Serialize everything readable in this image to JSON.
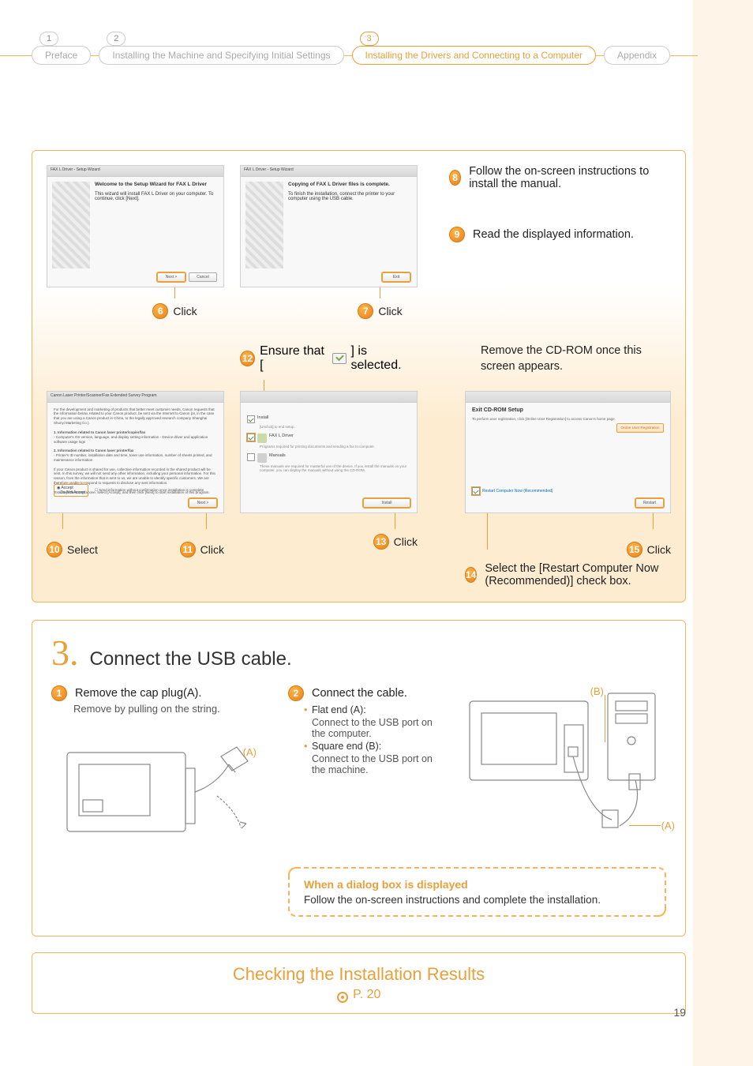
{
  "breadcrumb": {
    "items": [
      {
        "num": "1",
        "label": "Preface",
        "active": false
      },
      {
        "num": "2",
        "label": "Installing the Machine and Specifying Initial Settings",
        "active": false
      },
      {
        "num": "3",
        "label": "Installing the Drivers and Connecting to a Computer",
        "active": true
      },
      {
        "num": "",
        "label": "Appendix",
        "active": false
      }
    ]
  },
  "wizard1": {
    "titlebar": "FAX L Driver - Setup Wizard",
    "heading": "Welcome to the Setup Wizard for FAX L Driver",
    "body": "This wizard will install FAX L Driver on your computer. To continue, click [Next].",
    "buttons": {
      "next": "Next >",
      "cancel": "Cancel"
    }
  },
  "wizard2": {
    "titlebar": "FAX L Driver - Setup Wizard",
    "heading": "Copying of FAX L Driver files is complete.",
    "body": "To finish the installation, connect the printer to your computer using the USB cable.",
    "buttons": {
      "exit": "Exit"
    }
  },
  "steps": {
    "s6": "Click",
    "s7": "Click",
    "s8": "Follow the on-screen instructions to install the manual.",
    "s9": "Read the displayed information.",
    "s10": "Select",
    "s11": "Click",
    "s12_pre": "Ensure that [",
    "s12_post": "] is selected.",
    "s13": "Click",
    "s14": "Select the [Restart Computer Now (Recommended)] check box.",
    "s15": "Click",
    "remove_cd": "Remove the CD-ROM once this screen appears."
  },
  "license_shot": {
    "titlebar": "Canon Laser Printer/Scanner/Fax Extended Survey Program",
    "line1": "For the development and marketing of products that better meet customer needs, Canon requests that the information below, related to your Canon product, be sent via the Internet to Canon (or, in the case that you are using a Canon product in China, to the legally approved research company Shanghai Shunyi Marketing Co.).",
    "block1_title": "1. Information related to Canon laser printer/copier/fax",
    "block1_body": "- Computer's OS version, language, and display setting information\n- Device driver and application software usage logs",
    "block2_title": "2. Information related to Canon laser printer/fax",
    "block2_body": "- Printer's ID number, installation date and time, toner use information, number of sheets printed, and maintenance information",
    "block3": "If your Canon product is shared for use, collective information recorded in the shared product will be sent. In this survey, we will not send any other information, including your personal information. For this reason, from the information that is sent to us, we are unable to identify specific customers. We are therefore unable to respond to requests to disclose any sent information.",
    "footer": "To accept the terms above, select [Accept], and then click [Next] to start installation of this program.",
    "radio_accept": "Accept",
    "radio_decline": "Do Not Accept",
    "chk_label": "Send information without confirmation once installation is complete",
    "next": "Next >"
  },
  "select_shot": {
    "item1": "Install",
    "item1_sub": "[Unchck] to end setup.",
    "item2": "FAX L Driver",
    "item2_sub": "Programs required for printing documents and sending a fax to computer.",
    "item3": "Manuals",
    "item3_sub": "These manuals are required for masterful use of the device. If you install the manuals on your computer, you can display the manuals without using the CD-ROM.",
    "install": "Install"
  },
  "exit_shot": {
    "heading": "Exit CD-ROM Setup",
    "sub": "To perform user registration, click [Online User Registration] to access Canon's home page.",
    "reg_btn": "Online User Registration",
    "restart": "Restart Computer Now (Recommended)",
    "restart_btn": "Restart"
  },
  "section3": {
    "num": "3.",
    "heading": "Connect the USB cable.",
    "step1_title": "Remove the cap plug(A).",
    "step1_sub": "Remove by pulling on the string.",
    "step2_title": "Connect the cable.",
    "bullets": [
      {
        "main": "Flat end (A):",
        "sub": "Connect to the USB port on the computer."
      },
      {
        "main": "Square end (B):",
        "sub": "Connect to the USB port on the machine."
      }
    ],
    "label_a": "(A)",
    "label_b": "(B)",
    "label_a2": "(A)",
    "note_title": "When a dialog box is displayed",
    "note_body": "Follow the on-screen instructions and complete the installation."
  },
  "checking": {
    "title": "Checking the Installation Results",
    "page": "P. 20"
  },
  "page_number": "19"
}
